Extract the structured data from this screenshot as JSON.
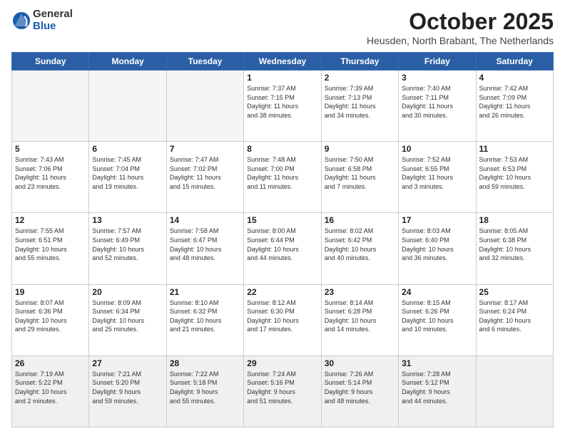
{
  "logo": {
    "general": "General",
    "blue": "Blue"
  },
  "header": {
    "month": "October 2025",
    "location": "Heusden, North Brabant, The Netherlands"
  },
  "weekdays": [
    "Sunday",
    "Monday",
    "Tuesday",
    "Wednesday",
    "Thursday",
    "Friday",
    "Saturday"
  ],
  "weeks": [
    [
      {
        "day": "",
        "info": ""
      },
      {
        "day": "",
        "info": ""
      },
      {
        "day": "",
        "info": ""
      },
      {
        "day": "1",
        "info": "Sunrise: 7:37 AM\nSunset: 7:15 PM\nDaylight: 11 hours\nand 38 minutes."
      },
      {
        "day": "2",
        "info": "Sunrise: 7:39 AM\nSunset: 7:13 PM\nDaylight: 11 hours\nand 34 minutes."
      },
      {
        "day": "3",
        "info": "Sunrise: 7:40 AM\nSunset: 7:11 PM\nDaylight: 11 hours\nand 30 minutes."
      },
      {
        "day": "4",
        "info": "Sunrise: 7:42 AM\nSunset: 7:09 PM\nDaylight: 11 hours\nand 26 minutes."
      }
    ],
    [
      {
        "day": "5",
        "info": "Sunrise: 7:43 AM\nSunset: 7:06 PM\nDaylight: 11 hours\nand 23 minutes."
      },
      {
        "day": "6",
        "info": "Sunrise: 7:45 AM\nSunset: 7:04 PM\nDaylight: 11 hours\nand 19 minutes."
      },
      {
        "day": "7",
        "info": "Sunrise: 7:47 AM\nSunset: 7:02 PM\nDaylight: 11 hours\nand 15 minutes."
      },
      {
        "day": "8",
        "info": "Sunrise: 7:48 AM\nSunset: 7:00 PM\nDaylight: 11 hours\nand 11 minutes."
      },
      {
        "day": "9",
        "info": "Sunrise: 7:50 AM\nSunset: 6:58 PM\nDaylight: 11 hours\nand 7 minutes."
      },
      {
        "day": "10",
        "info": "Sunrise: 7:52 AM\nSunset: 6:55 PM\nDaylight: 11 hours\nand 3 minutes."
      },
      {
        "day": "11",
        "info": "Sunrise: 7:53 AM\nSunset: 6:53 PM\nDaylight: 10 hours\nand 59 minutes."
      }
    ],
    [
      {
        "day": "12",
        "info": "Sunrise: 7:55 AM\nSunset: 6:51 PM\nDaylight: 10 hours\nand 55 minutes."
      },
      {
        "day": "13",
        "info": "Sunrise: 7:57 AM\nSunset: 6:49 PM\nDaylight: 10 hours\nand 52 minutes."
      },
      {
        "day": "14",
        "info": "Sunrise: 7:58 AM\nSunset: 6:47 PM\nDaylight: 10 hours\nand 48 minutes."
      },
      {
        "day": "15",
        "info": "Sunrise: 8:00 AM\nSunset: 6:44 PM\nDaylight: 10 hours\nand 44 minutes."
      },
      {
        "day": "16",
        "info": "Sunrise: 8:02 AM\nSunset: 6:42 PM\nDaylight: 10 hours\nand 40 minutes."
      },
      {
        "day": "17",
        "info": "Sunrise: 8:03 AM\nSunset: 6:40 PM\nDaylight: 10 hours\nand 36 minutes."
      },
      {
        "day": "18",
        "info": "Sunrise: 8:05 AM\nSunset: 6:38 PM\nDaylight: 10 hours\nand 32 minutes."
      }
    ],
    [
      {
        "day": "19",
        "info": "Sunrise: 8:07 AM\nSunset: 6:36 PM\nDaylight: 10 hours\nand 29 minutes."
      },
      {
        "day": "20",
        "info": "Sunrise: 8:09 AM\nSunset: 6:34 PM\nDaylight: 10 hours\nand 25 minutes."
      },
      {
        "day": "21",
        "info": "Sunrise: 8:10 AM\nSunset: 6:32 PM\nDaylight: 10 hours\nand 21 minutes."
      },
      {
        "day": "22",
        "info": "Sunrise: 8:12 AM\nSunset: 6:30 PM\nDaylight: 10 hours\nand 17 minutes."
      },
      {
        "day": "23",
        "info": "Sunrise: 8:14 AM\nSunset: 6:28 PM\nDaylight: 10 hours\nand 14 minutes."
      },
      {
        "day": "24",
        "info": "Sunrise: 8:15 AM\nSunset: 6:26 PM\nDaylight: 10 hours\nand 10 minutes."
      },
      {
        "day": "25",
        "info": "Sunrise: 8:17 AM\nSunset: 6:24 PM\nDaylight: 10 hours\nand 6 minutes."
      }
    ],
    [
      {
        "day": "26",
        "info": "Sunrise: 7:19 AM\nSunset: 5:22 PM\nDaylight: 10 hours\nand 2 minutes."
      },
      {
        "day": "27",
        "info": "Sunrise: 7:21 AM\nSunset: 5:20 PM\nDaylight: 9 hours\nand 59 minutes."
      },
      {
        "day": "28",
        "info": "Sunrise: 7:22 AM\nSunset: 5:18 PM\nDaylight: 9 hours\nand 55 minutes."
      },
      {
        "day": "29",
        "info": "Sunrise: 7:24 AM\nSunset: 5:16 PM\nDaylight: 9 hours\nand 51 minutes."
      },
      {
        "day": "30",
        "info": "Sunrise: 7:26 AM\nSunset: 5:14 PM\nDaylight: 9 hours\nand 48 minutes."
      },
      {
        "day": "31",
        "info": "Sunrise: 7:28 AM\nSunset: 5:12 PM\nDaylight: 9 hours\nand 44 minutes."
      },
      {
        "day": "",
        "info": ""
      }
    ]
  ]
}
